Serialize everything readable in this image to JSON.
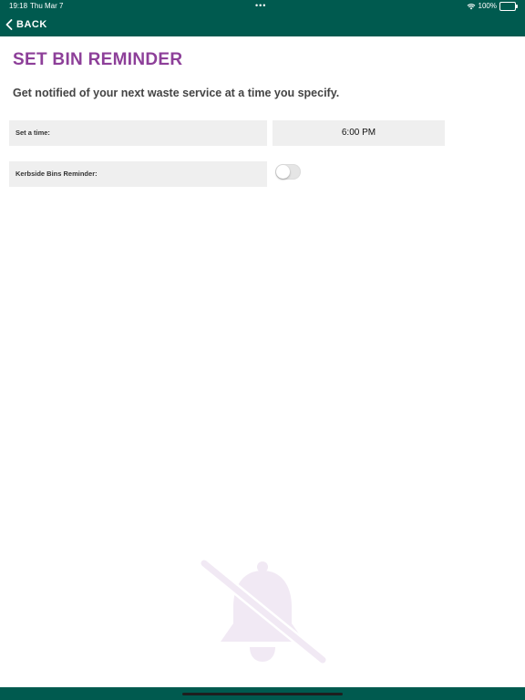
{
  "status_bar": {
    "time": "19:18",
    "date": "Thu Mar 7",
    "battery": "100%",
    "battery_level": 1.0
  },
  "nav": {
    "back_label": "BACK",
    "back_icon": "chevron-left-icon"
  },
  "page": {
    "title": "SET BIN REMINDER",
    "subtitle": "Get notified of your next waste service at a time you specify."
  },
  "settings": {
    "time_label": "Set a time:",
    "time_value": "6:00 PM",
    "reminder_label": "Kerbside Bins Reminder:",
    "reminder_enabled": false
  },
  "illustration": {
    "icon": "bell-slash-icon"
  },
  "colors": {
    "header_bg": "#005a4f",
    "title": "#8d3f99",
    "row_bg": "#efefef",
    "bell": "#f1e9f4"
  }
}
